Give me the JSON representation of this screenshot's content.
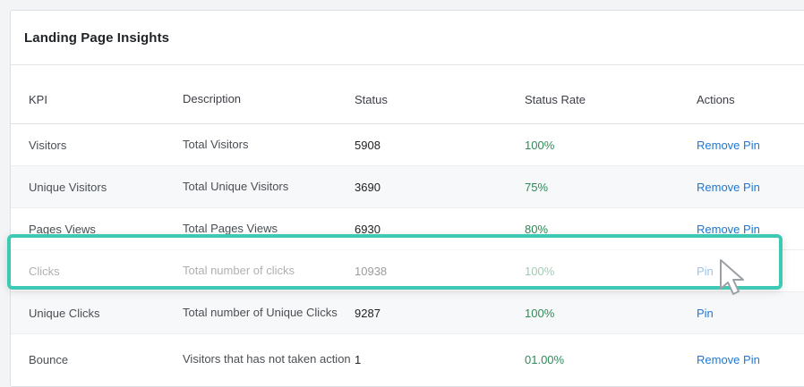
{
  "card": {
    "title": "Landing Page Insights"
  },
  "table": {
    "columns": [
      "KPI",
      "Description",
      "Status",
      "Status Rate",
      "Actions"
    ],
    "rows": [
      {
        "kpi": "Visitors",
        "description": "Total Visitors",
        "status": "5908",
        "rate": "100%",
        "action": "Remove Pin"
      },
      {
        "kpi": "Unique Visitors",
        "description": "Total Unique Visitors",
        "status": "3690",
        "rate": "75%",
        "action": "Remove Pin"
      },
      {
        "kpi": "Pages Views",
        "description": "Total Pages Views",
        "status": "6930",
        "rate": "80%",
        "action": "Remove Pin"
      },
      {
        "kpi": "Clicks",
        "description": "Total number of clicks",
        "status": "10938",
        "rate": "100%",
        "action": "Pin"
      },
      {
        "kpi": "Unique Clicks",
        "description": "Total number of Unique Clicks",
        "status": "9287",
        "rate": "100%",
        "action": "Pin"
      },
      {
        "kpi": "Bounce",
        "description": "Visitors that has not taken action",
        "status": "1",
        "rate": "01.00%",
        "action": "Remove Pin"
      }
    ]
  },
  "colors": {
    "accent": "#3ec9b4",
    "link": "#1f78d1",
    "positive": "#2e8b57"
  },
  "icons": {
    "cursor": "mouse-pointer-icon"
  }
}
